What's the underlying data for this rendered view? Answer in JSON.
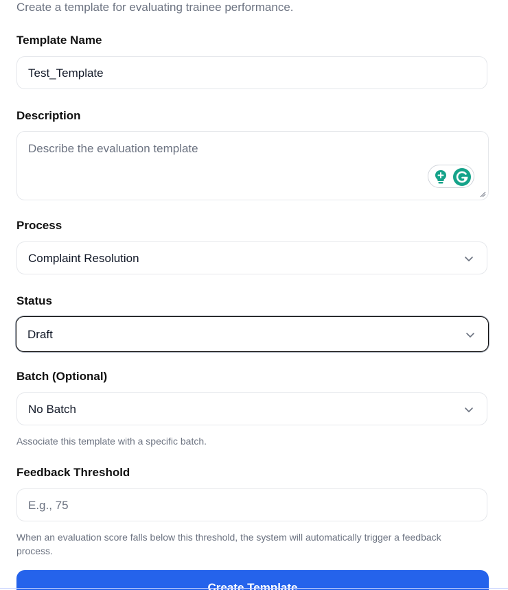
{
  "subtitle": "Create a template for evaluating trainee performance.",
  "template_name": {
    "label": "Template Name",
    "value": "Test_Template"
  },
  "description": {
    "label": "Description",
    "placeholder": "Describe the evaluation template"
  },
  "process": {
    "label": "Process",
    "selected": "Complaint Resolution"
  },
  "status": {
    "label": "Status",
    "selected": "Draft"
  },
  "batch": {
    "label": "Batch (Optional)",
    "selected": "No Batch",
    "helper": "Associate this template with a specific batch."
  },
  "feedback_threshold": {
    "label": "Feedback Threshold",
    "placeholder": "E.g., 75",
    "helper_line1": "When an evaluation score falls below this threshold, the system will automatically trigger a feedback",
    "helper_line2": "process."
  },
  "create_button": {
    "label": "Create Template"
  },
  "icons": {
    "grammarly_suggestion": "lightbulb-icon",
    "grammarly_logo": "grammarly-g-icon",
    "dropdown": "chevron-down-icon"
  },
  "colors": {
    "primary_button": "#2563eb",
    "grammarly_green": "#15a38a"
  }
}
